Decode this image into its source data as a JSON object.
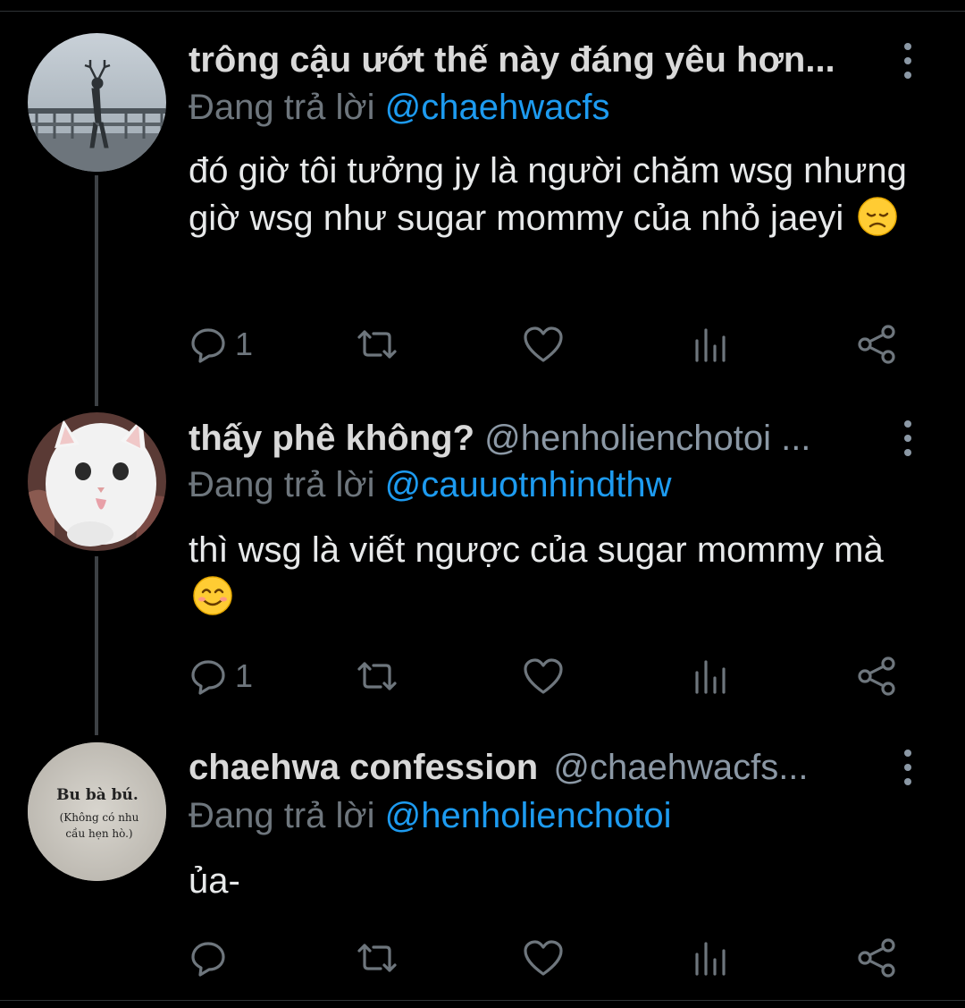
{
  "tweets": [
    {
      "name": "trông cậu ướt thế này đáng yêu hơn...",
      "handle": "",
      "replying_prefix": "Đang trả lời ",
      "replying_to": "@chaehwacfs",
      "text": "đó giờ tôi tưởng jy là người chăm wsg nhưng giờ wsg như sugar mommy của nhỏ jaeyi",
      "emoji": "disappointed-face",
      "reply_count": "1",
      "avatar": "deer-statue-on-bridge-photo"
    },
    {
      "name": "thấy phê không?",
      "handle": "@henholienchotoi ...",
      "replying_prefix": "Đang trả lời ",
      "replying_to": "@cauuotnhindthw",
      "text": "thì wsg là viết ngược của sugar mommy mà",
      "emoji": "smiling-face",
      "reply_count": "1",
      "avatar": "white-kitten-photo"
    },
    {
      "name": "chaehwa confession",
      "handle": "@chaehwacfs...",
      "replying_prefix": "Đang trả lời ",
      "replying_to": "@henholienchotoi",
      "text": "ủa-",
      "emoji": "",
      "reply_count": "",
      "avatar": "text-paper-photo",
      "avatar_text": {
        "line1": "Bu bà bú.",
        "line2": "(Không có nhu",
        "line3": "cầu hẹn hò.)"
      }
    }
  ],
  "colors": {
    "background": "#000000",
    "text": "#e7e9ea",
    "muted": "#6e767d",
    "link": "#1d9bf0"
  }
}
